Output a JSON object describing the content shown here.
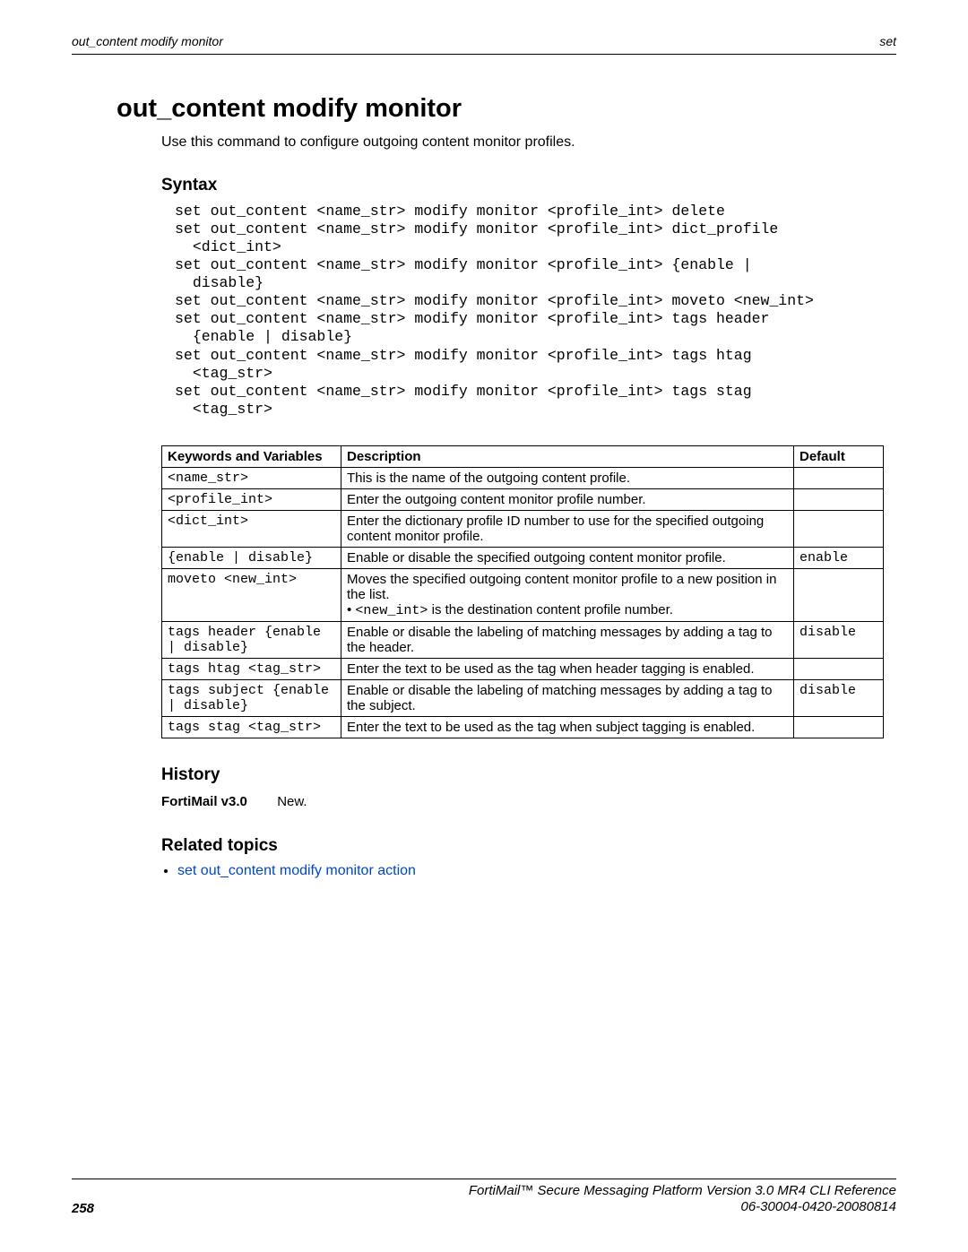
{
  "header": {
    "left": "out_content modify monitor",
    "right": "set"
  },
  "title": "out_content modify monitor",
  "intro": "Use this command to configure outgoing content monitor profiles.",
  "syntax_heading": "Syntax",
  "syntax_block": "set out_content <name_str> modify monitor <profile_int> delete\nset out_content <name_str> modify monitor <profile_int> dict_profile\n  <dict_int>\nset out_content <name_str> modify monitor <profile_int> {enable |\n  disable}\nset out_content <name_str> modify monitor <profile_int> moveto <new_int>\nset out_content <name_str> modify monitor <profile_int> tags header\n  {enable | disable}\nset out_content <name_str> modify monitor <profile_int> tags htag\n  <tag_str>\nset out_content <name_str> modify monitor <profile_int> tags stag\n  <tag_str>",
  "table": {
    "headers": {
      "kw": "Keywords and Variables",
      "desc": "Description",
      "def": "Default"
    },
    "rows": [
      {
        "kw": "<name_str>",
        "desc_html": "This is the name of the outgoing content profile.",
        "def": ""
      },
      {
        "kw": "<profile_int>",
        "desc_html": "Enter the outgoing content monitor profile number.",
        "def": ""
      },
      {
        "kw": "<dict_int>",
        "desc_html": "Enter the dictionary profile ID number to use for the specified outgoing content monitor profile.",
        "def": ""
      },
      {
        "kw": "{enable | disable}",
        "desc_html": "Enable or disable the specified outgoing content monitor profile.",
        "def": "enable"
      },
      {
        "kw": "moveto <new_int>",
        "desc_html": "Moves the specified outgoing content monitor profile to a new position in the list.<br>• <span class=\"mono\">&lt;new_int&gt;</span> is the destination content profile number.",
        "def": ""
      },
      {
        "kw": "tags header {enable | disable}",
        "desc_html": "Enable or disable the labeling of matching messages by adding a tag to the header.",
        "def": "disable"
      },
      {
        "kw": "tags htag <tag_str>",
        "desc_html": "Enter the text to be used as the tag when header tagging is enabled.",
        "def": ""
      },
      {
        "kw": "tags subject {enable | disable}",
        "desc_html": "Enable or disable the labeling of matching messages by adding a tag to the subject.",
        "def": "disable"
      },
      {
        "kw": "tags stag <tag_str>",
        "desc_html": "Enter the text to be used as the tag when subject tagging is enabled.",
        "def": ""
      }
    ]
  },
  "history_heading": "History",
  "history_version": "FortiMail v3.0",
  "history_note": "New.",
  "related_heading": "Related topics",
  "related_links": [
    "set out_content modify monitor action"
  ],
  "footer": {
    "page_number": "258",
    "product_line": "FortiMail™ Secure Messaging Platform Version 3.0 MR4 CLI Reference",
    "doc_id": "06-30004-0420-20080814"
  }
}
